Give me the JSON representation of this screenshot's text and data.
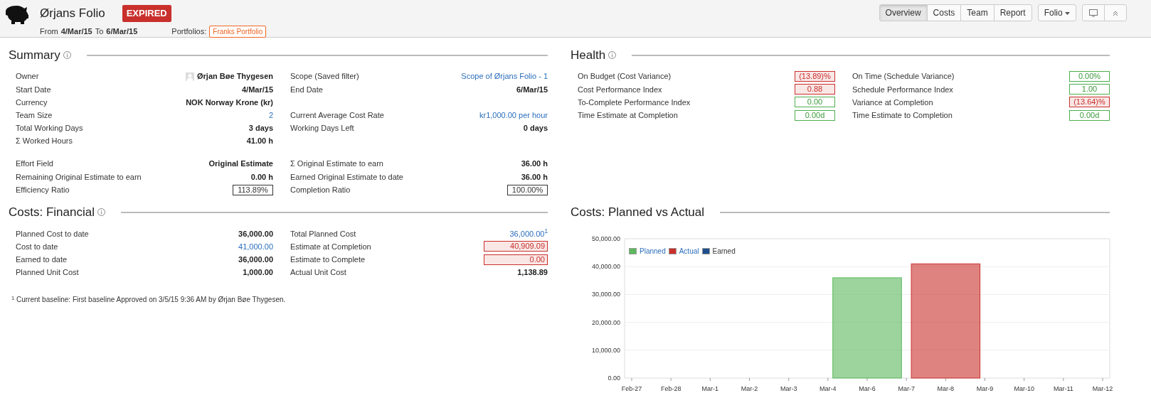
{
  "header": {
    "title": "Ørjans Folio",
    "status": "EXPIRED",
    "from_label": "From",
    "start": "4/Mar/15",
    "to_label": "To",
    "end": "6/Mar/15",
    "portfolios_label": "Portfolios:",
    "portfolio_tag": "Franks Portfolio",
    "tabs": [
      {
        "label": "Overview",
        "selected": true
      },
      {
        "label": "Costs",
        "selected": false
      },
      {
        "label": "Team",
        "selected": false
      },
      {
        "label": "Report",
        "selected": false
      }
    ],
    "menu": {
      "label": "Folio"
    }
  },
  "summary": {
    "title": "Summary",
    "info": true,
    "groups": [
      [
        {
          "left": {
            "label": "Owner",
            "value": "Ørjan Bøe Thygesen",
            "kind": "person"
          },
          "right": {
            "label": "Scope (Saved filter)",
            "value": "Scope of Ørjans Folio - 1",
            "kind": "link"
          }
        },
        {
          "left": {
            "label": "Start Date",
            "value": "4/Mar/15",
            "kind": "bold"
          },
          "right": {
            "label": "End Date",
            "value": "6/Mar/15",
            "kind": "bold"
          }
        },
        {
          "left": {
            "label": "Currency",
            "value": "NOK Norway Krone (kr)",
            "kind": "bold"
          }
        },
        {
          "left": {
            "label": "Team Size",
            "value": "2",
            "kind": "link"
          },
          "right": {
            "label": "Current Average Cost Rate",
            "value": "kr1,000.00 per hour",
            "kind": "link"
          }
        },
        {
          "left": {
            "label": "Total Working Days",
            "value": "3 days",
            "kind": "bold"
          },
          "right": {
            "label": "Working Days Left",
            "value": "0 days",
            "kind": "bold"
          }
        },
        {
          "left": {
            "label": "Σ Worked Hours",
            "value": "41.00 h",
            "kind": "bold"
          }
        }
      ],
      [
        {
          "left": {
            "label": "Effort Field",
            "value": "Original Estimate",
            "kind": "bold"
          },
          "right": {
            "label": "Σ Original Estimate to earn",
            "value": "36.00 h",
            "kind": "bold"
          }
        },
        {
          "left": {
            "label": "Remaining Original Estimate to earn",
            "value": "0.00 h",
            "kind": "bold"
          },
          "right": {
            "label": "Earned Original Estimate to date",
            "value": "36.00 h",
            "kind": "bold"
          }
        },
        {
          "left": {
            "label": "Efficiency Ratio",
            "value": "113.89%",
            "kind": "boxed"
          },
          "right": {
            "label": "Completion Ratio",
            "value": "100.00%",
            "kind": "boxed"
          }
        }
      ]
    ]
  },
  "health": {
    "title": "Health",
    "info": true,
    "groups": [
      [
        {
          "left": {
            "label": "On Budget (Cost Variance)",
            "value": "(13.89)%",
            "kind": "bad"
          },
          "right": {
            "label": "On Time (Schedule Variance)",
            "value": "0.00%",
            "kind": "good"
          }
        },
        {
          "left": {
            "label": "Cost Performance Index",
            "value": "0.88",
            "kind": "bad"
          },
          "right": {
            "label": "Schedule Performance Index",
            "value": "1.00",
            "kind": "good"
          }
        },
        {
          "left": {
            "label": "To-Complete Performance Index",
            "value": "0.00",
            "kind": "good"
          },
          "right": {
            "label": "Variance at Completion",
            "value": "(13.64)%",
            "kind": "bad"
          }
        },
        {
          "left": {
            "label": "Time Estimate at Completion",
            "value": "0.00d",
            "kind": "good"
          },
          "right": {
            "label": "Time Estimate to Completion",
            "value": "0.00d",
            "kind": "good"
          }
        }
      ]
    ]
  },
  "costs": {
    "title": "Costs: Financial",
    "info": true,
    "groups": [
      [
        {
          "left": {
            "label": "Planned Cost to date",
            "value": "36,000.00",
            "kind": "bold"
          },
          "right": {
            "label": "Total Planned Cost",
            "value": "36,000.00$^{1}$",
            "kind": "link"
          }
        },
        {
          "left": {
            "label": "Cost to date",
            "value": "41,000.00",
            "kind": "link"
          },
          "right": {
            "label": "Estimate at Completion",
            "value": "40,909.09",
            "kind": "alert"
          }
        },
        {
          "left": {
            "label": "Earned to date",
            "value": "36,000.00",
            "kind": "bold"
          },
          "right": {
            "label": "Estimate to Complete",
            "value": "0.00",
            "kind": "alert"
          }
        },
        {
          "left": {
            "label": "Planned Unit Cost",
            "value": "1,000.00",
            "kind": "bold"
          },
          "right": {
            "label": "Actual Unit Cost",
            "value": "1,138.89",
            "kind": "bold"
          }
        }
      ]
    ],
    "footnote": "$^{1}$ Current baseline: First baseline Approved on 3/5/15 9:36 AM by Ørjan Bøe Thygesen."
  },
  "chart_section": {
    "title": "Costs: Planned vs Actual",
    "chart_data": {
      "type": "bar",
      "categories": [
        "Feb-27",
        "Feb-28",
        "Mar-1",
        "Mar-2",
        "Mar-3",
        "Mar-4",
        "Mar-6",
        "Mar-7",
        "Mar-8",
        "Mar-9",
        "Mar-10",
        "Mar-11",
        "Mar-12"
      ],
      "series": [
        {
          "name": "Planned",
          "color": "#5cb85c",
          "values": [
            null,
            null,
            null,
            null,
            null,
            null,
            36000,
            null,
            null,
            null,
            null,
            null,
            null
          ]
        },
        {
          "name": "Actual",
          "color": "#c9302c",
          "values": [
            null,
            null,
            null,
            null,
            null,
            null,
            null,
            null,
            41000,
            null,
            null,
            null,
            null
          ]
        },
        {
          "name": "Earned",
          "color": "#1f4e8c",
          "values": [
            null,
            null,
            null,
            null,
            null,
            null,
            null,
            null,
            null,
            null,
            null,
            null,
            null
          ]
        }
      ],
      "grid": true,
      "ylim": [
        0,
        50000
      ],
      "yticks": [
        {
          "value": 0,
          "label": "0.00"
        },
        {
          "value": 10000,
          "label": "10,000.00"
        },
        {
          "value": 20000,
          "label": "20,000.00"
        },
        {
          "value": 30000,
          "label": "30,000.00"
        },
        {
          "value": 40000,
          "label": "40,000.00"
        },
        {
          "value": 50000,
          "label": "50,000.00"
        }
      ]
    }
  }
}
